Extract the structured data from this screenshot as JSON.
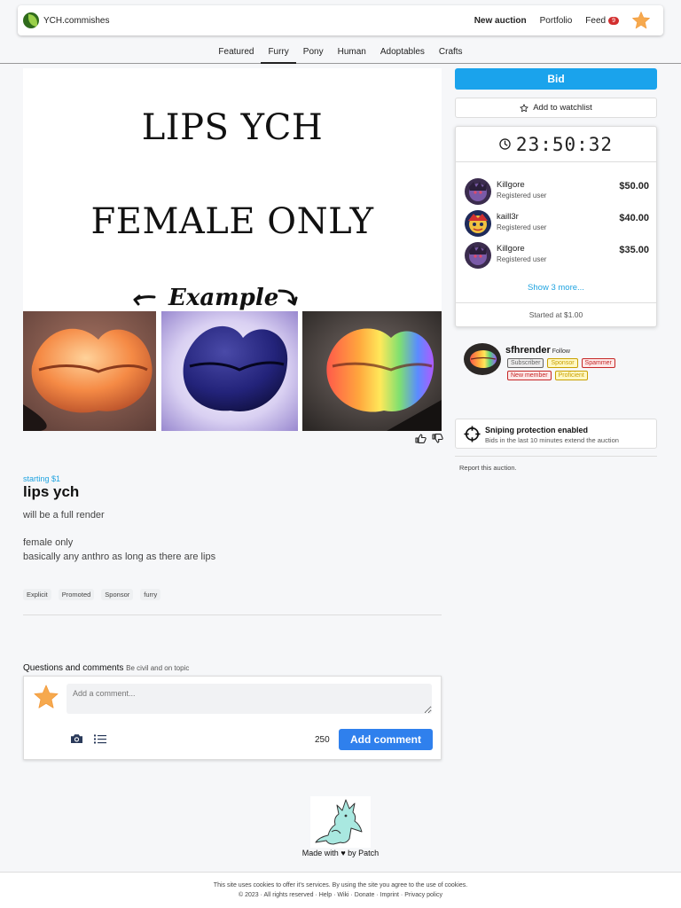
{
  "brand": {
    "name": "YCH.commishes"
  },
  "nav": {
    "new_auction": "New auction",
    "portfolio": "Portfolio",
    "feed": "Feed",
    "feed_count": "9"
  },
  "categories": [
    "Featured",
    "Furry",
    "Pony",
    "Human",
    "Adoptables",
    "Crafts"
  ],
  "active_category": "Furry",
  "hero": {
    "line1": "LIPS YCH",
    "line2": "FEMALE ONLY",
    "example": "Example"
  },
  "auction": {
    "starting": "starting $1",
    "title": "lips ych",
    "desc1": "will be a full render",
    "desc2": "female only",
    "desc3": "basically any anthro as long as there are lips",
    "tags": [
      "Explicit",
      "Promoted",
      "Sponsor",
      "furry"
    ]
  },
  "comments": {
    "heading": "Questions and comments",
    "subheading": "Be civil and on topic",
    "placeholder": "Add a comment...",
    "char_count": "250",
    "submit": "Add comment"
  },
  "bid_panel": {
    "bid_label": "Bid",
    "watchlist_label": "Add to watchlist",
    "timer": "23:50:32",
    "bids": [
      {
        "name": "Killgore",
        "role": "Registered user",
        "amount": "$50.00"
      },
      {
        "name": "kaill3r",
        "role": "Registered user",
        "amount": "$40.00"
      },
      {
        "name": "Killgore",
        "role": "Registered user",
        "amount": "$35.00"
      }
    ],
    "show_more": "Show 3 more...",
    "started_at": "Started at $1.00"
  },
  "seller": {
    "name": "sfhrender",
    "follow": "Follow",
    "badges": [
      {
        "label": "Subscriber",
        "color": "#666666",
        "bg": "#eeeeee"
      },
      {
        "label": "Sponsor",
        "color": "#c9a000",
        "bg": "#fff8c4"
      },
      {
        "label": "Spammer",
        "color": "#c62828",
        "bg": "#fde8e8"
      },
      {
        "label": "New member",
        "color": "#c62828",
        "bg": "#fde8e8"
      },
      {
        "label": "Proficient",
        "color": "#c9a000",
        "bg": "#fff8c4"
      }
    ]
  },
  "sniping": {
    "title": "Sniping protection enabled",
    "text": "Bids in the last 10 minutes extend the auction"
  },
  "report": "Report this auction.",
  "footer": {
    "made_with": "Made with ♥ by Patch",
    "cookies": "This site uses cookies to offer it's services. By using the site you agree to the use of cookies.",
    "links": "© 2023 · All rights reserved · Help · Wiki · Donate · Imprint · Privacy policy"
  },
  "colors": {
    "accent": "#1aa3ec",
    "comment_button": "#2f80ed",
    "link": "#1fa3e0"
  }
}
